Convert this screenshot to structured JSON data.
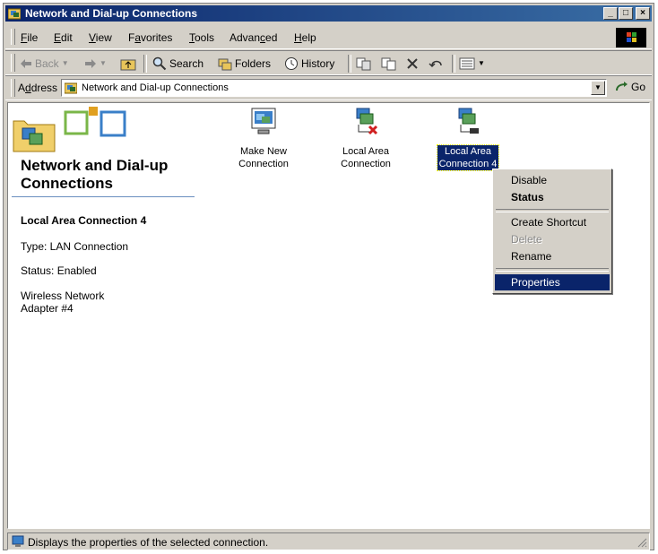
{
  "window": {
    "title": "Network and Dial-up Connections",
    "minimize_glyph": "_",
    "maximize_glyph": "□",
    "close_glyph": "×"
  },
  "menu": {
    "items": [
      {
        "label": "File",
        "accel": "F",
        "rest": "ile"
      },
      {
        "label": "Edit",
        "accel": "E",
        "rest": "dit"
      },
      {
        "label": "View",
        "accel": "V",
        "rest": "iew"
      },
      {
        "label": "Favorites",
        "pre": "F",
        "accel": "a",
        "rest": "vorites"
      },
      {
        "label": "Tools",
        "accel": "T",
        "rest": "ools"
      },
      {
        "label": "Advanced",
        "pre": "Advan",
        "accel": "c",
        "rest": "ed"
      },
      {
        "label": "Help",
        "accel": "H",
        "rest": "elp"
      }
    ]
  },
  "toolbar": {
    "back_label": "Back",
    "search_label": "Search",
    "folders_label": "Folders",
    "history_label": "History"
  },
  "address": {
    "label_pre": "A",
    "label_accel": "d",
    "label_rest": "dress",
    "value": "Network and Dial-up Connections",
    "go_label": "Go"
  },
  "panel": {
    "title": "Network and Dial-up Connections",
    "connection_name": "Local Area Connection 4",
    "type": "Type: LAN Connection",
    "status": "Status: Enabled",
    "adapter": "Wireless Network Adapter #4"
  },
  "icons": [
    {
      "label_line1": "Make New",
      "label_line2": "Connection"
    },
    {
      "label_line1": "Local Area",
      "label_line2": "Connection"
    },
    {
      "label_line1": "Local Area",
      "label_line2": "Connection 4",
      "selected": true
    }
  ],
  "context_menu": {
    "disable": "Disable",
    "status": "Status",
    "create_shortcut": "Create Shortcut",
    "delete": "Delete",
    "rename": "Rename",
    "properties": "Properties"
  },
  "statusbar": {
    "text": "Displays the properties of the selected connection."
  }
}
